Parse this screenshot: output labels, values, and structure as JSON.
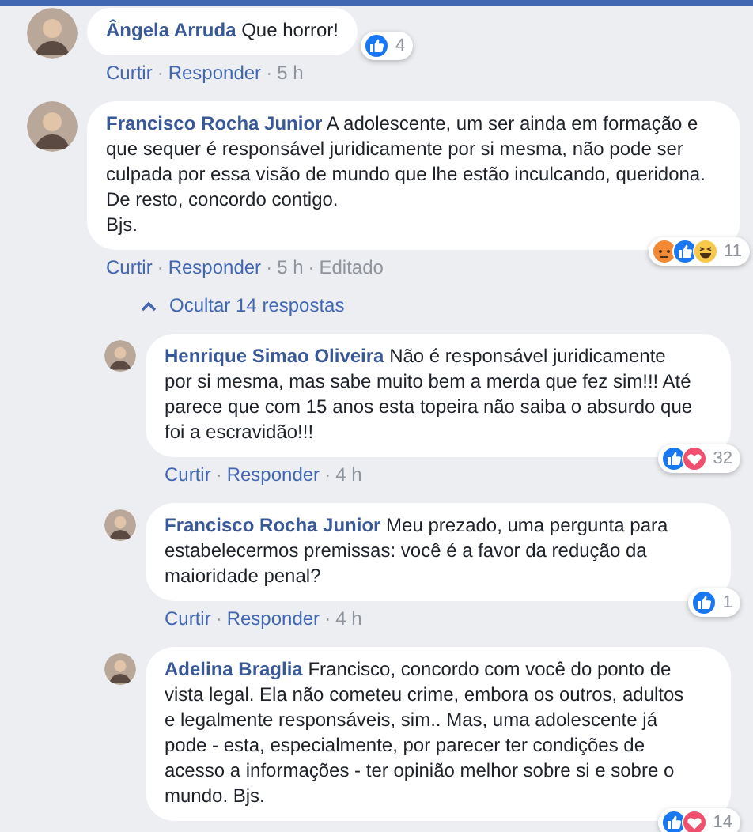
{
  "comments": [
    {
      "author": "Ângela Arruda",
      "text": "Que horror!",
      "reactions": [
        {
          "kind": "like"
        }
      ],
      "reaction_count": "4",
      "actions": [
        "Curtir",
        "·",
        "Responder",
        "·",
        "5 h"
      ],
      "inline_badge": true
    },
    {
      "author": "Francisco Rocha Junior",
      "text": "A adolescente, um ser ainda em formação e que sequer é responsável juridicamente por si mesma, não pode ser culpada por essa visão de mundo que lhe estão inculcando, queridona. De resto, concordo contigo.\nBjs.",
      "reactions": [
        {
          "kind": "angry"
        },
        {
          "kind": "like"
        },
        {
          "kind": "haha"
        }
      ],
      "reaction_count": "11",
      "actions": [
        "Curtir",
        "·",
        "Responder",
        "·",
        "5 h",
        "·",
        "Editado"
      ],
      "inline_badge": false,
      "replies_toggle": "Ocultar 14 respostas",
      "replies": [
        {
          "author": "Henrique Simao Oliveira",
          "text": "Não é responsável juridicamente por si mesma, mas sabe muito bem a merda que fez sim!!! Até parece que com 15 anos esta topeira não saiba o absurdo que foi a escravidão!!!",
          "reactions": [
            {
              "kind": "like"
            },
            {
              "kind": "love"
            }
          ],
          "reaction_count": "32",
          "actions": [
            "Curtir",
            "·",
            "Responder",
            "·",
            "4 h"
          ]
        },
        {
          "author": "Francisco Rocha Junior",
          "text": "Meu prezado, uma pergunta para estabelecermos premissas: você é a favor da redução da maioridade penal?",
          "reactions": [
            {
              "kind": "like"
            }
          ],
          "reaction_count": "1",
          "actions": [
            "Curtir",
            "·",
            "Responder",
            "·",
            "4 h"
          ]
        },
        {
          "author": "Adelina Braglia",
          "text": "Francisco, concordo com você do ponto de vista legal. Ela não cometeu crime, embora os outros, adultos e legalmente responsáveis, sim.. Mas, uma adolescente já pode - esta, especialmente, por parecer ter condições de acesso a informações - ter opinião melhor sobre si e sobre o mundo. Bjs.",
          "reactions": [
            {
              "kind": "like"
            },
            {
              "kind": "love"
            }
          ],
          "reaction_count": "14"
        }
      ]
    }
  ]
}
